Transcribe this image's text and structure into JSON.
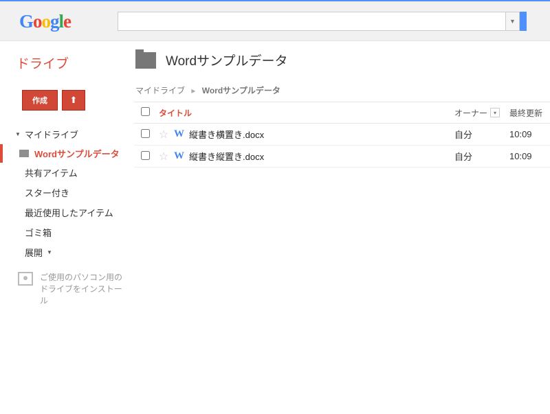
{
  "header": {
    "logo_text": "Google",
    "search_value": ""
  },
  "sidebar": {
    "drive_label": "ドライブ",
    "create_label": "作成",
    "nav": {
      "my_drive": "マイドライブ",
      "current_folder": "Wordサンプルデータ",
      "shared": "共有アイテム",
      "starred": "スター付き",
      "recent": "最近使用したアイテム",
      "trash": "ゴミ箱",
      "expand": "展開"
    },
    "install_text": "ご使用のパソコン用のドライブをインストール"
  },
  "main": {
    "folder_title": "Wordサンプルデータ",
    "breadcrumb": {
      "root": "マイドライブ",
      "current": "Wordサンプルデータ"
    },
    "columns": {
      "title": "タイトル",
      "owner": "オーナー",
      "modified": "最終更新"
    },
    "files": [
      {
        "name": "縦書き横置き.docx",
        "owner": "自分",
        "time": "10:09"
      },
      {
        "name": "縦書き縦置き.docx",
        "owner": "自分",
        "time": "10:09"
      }
    ]
  }
}
